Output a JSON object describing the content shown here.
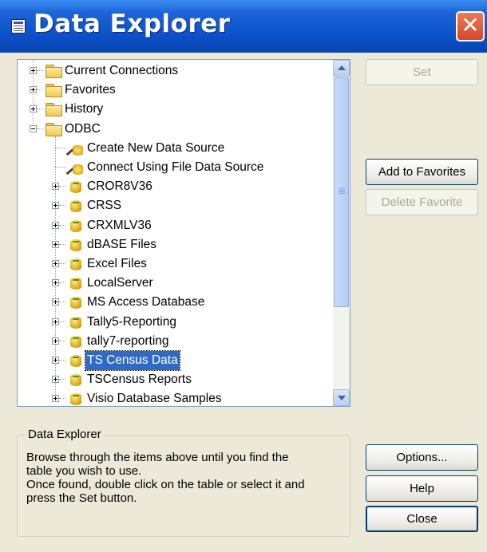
{
  "window": {
    "title": "Data Explorer",
    "close_symbol": "✕",
    "title_icon": "data-explorer-icon",
    "colors": {
      "titlebar": "#0B50C8",
      "close_button": "#D6482A",
      "face": "#ECE9D8",
      "selection": "#316AC5"
    }
  },
  "tree": {
    "items": [
      {
        "label": "Current Connections",
        "icon": "folder-icon",
        "expander": "plus"
      },
      {
        "label": "Favorites",
        "icon": "folder-icon",
        "expander": "plus"
      },
      {
        "label": "History",
        "icon": "folder-icon",
        "expander": "plus"
      },
      {
        "label": "ODBC",
        "icon": "folder-icon",
        "expander": "minus"
      },
      {
        "label": "Create New Data Source",
        "icon": "magic-wand-icon",
        "expander": "none"
      },
      {
        "label": "Connect Using File Data Source",
        "icon": "magic-wand-icon",
        "expander": "none"
      },
      {
        "label": "CROR8V36",
        "icon": "database-icon",
        "expander": "plus"
      },
      {
        "label": "CRSS",
        "icon": "database-icon",
        "expander": "plus"
      },
      {
        "label": "CRXMLV36",
        "icon": "database-icon",
        "expander": "plus"
      },
      {
        "label": "dBASE Files",
        "icon": "database-icon",
        "expander": "plus"
      },
      {
        "label": "Excel Files",
        "icon": "database-icon",
        "expander": "plus"
      },
      {
        "label": "LocalServer",
        "icon": "database-icon",
        "expander": "plus"
      },
      {
        "label": "MS Access Database",
        "icon": "database-icon",
        "expander": "plus"
      },
      {
        "label": "Tally5-Reporting",
        "icon": "database-icon",
        "expander": "plus"
      },
      {
        "label": "tally7-reporting",
        "icon": "database-icon",
        "expander": "plus"
      },
      {
        "label": "TS Census Data",
        "icon": "database-connected-icon",
        "expander": "plus",
        "selected": true
      },
      {
        "label": "TSCensus Reports",
        "icon": "database-icon",
        "expander": "plus"
      },
      {
        "label": "Visio Database Samples",
        "icon": "database-icon",
        "expander": "plus"
      }
    ]
  },
  "buttons": {
    "set": "Set",
    "add_to_favorites": "Add to Favorites",
    "delete_favorite": "Delete Favorite",
    "options": "Options...",
    "help": "Help",
    "close": "Close"
  },
  "info": {
    "legend": "Data Explorer",
    "text": "Browse through the items above until you find the\ntable you wish to use.\nOnce found, double click on the table or select it and\npress the Set button."
  }
}
